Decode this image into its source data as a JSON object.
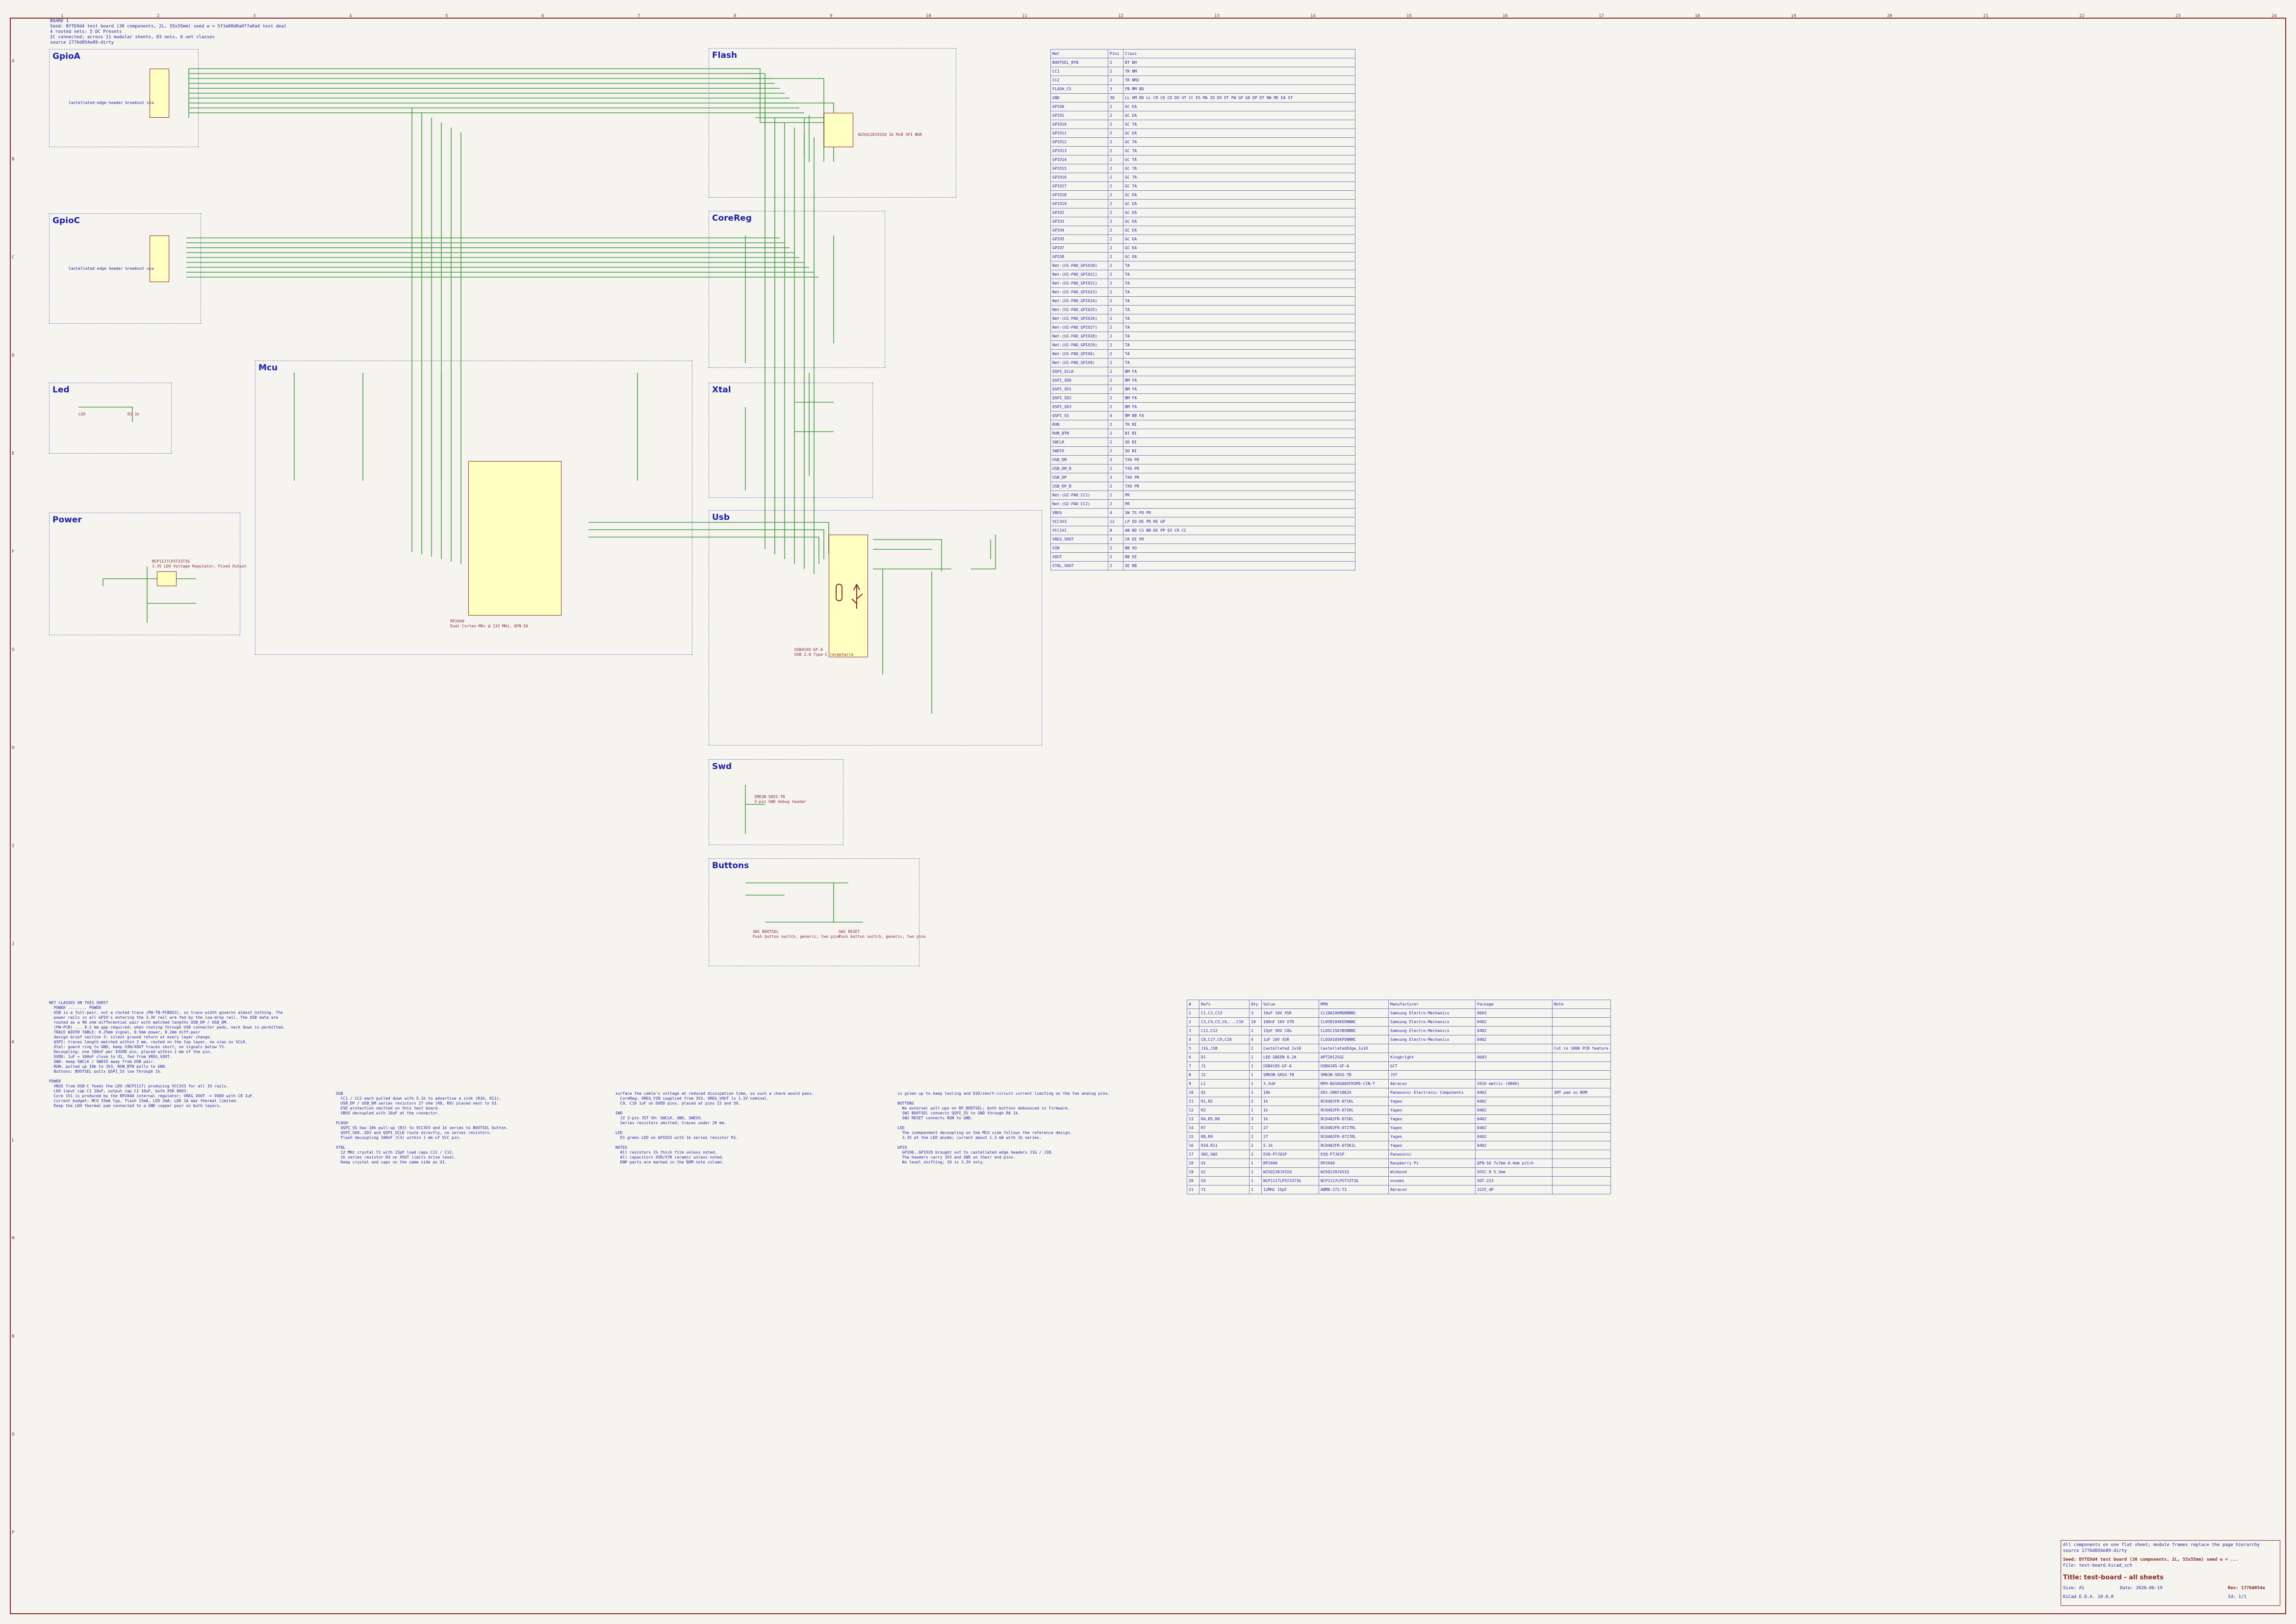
{
  "header": {
    "text": "BOARD 1\nSeed: BYTE0d4 test board (30 components, 2L, 55x55mm) seed w = 5f3a00d0a0f7a0a4 test deal\n4 rooted nets: 5 DC Presets\nIC connected; across 11 modular sheets, 83 nets, 8 net classes\nsource 1776d054e89-dirty"
  },
  "sheets": [
    {
      "id": "gpioa",
      "title": "GpioA"
    },
    {
      "id": "gpioc",
      "title": "GpioC"
    },
    {
      "id": "led",
      "title": "Led"
    },
    {
      "id": "power",
      "title": "Power"
    },
    {
      "id": "mcu",
      "title": "Mcu"
    },
    {
      "id": "flash",
      "title": "Flash"
    },
    {
      "id": "corereg",
      "title": "CoreReg"
    },
    {
      "id": "xtal",
      "title": "Xtal"
    },
    {
      "id": "usb",
      "title": "Usb"
    },
    {
      "id": "swd",
      "title": "Swd"
    },
    {
      "id": "buttons",
      "title": "Buttons"
    }
  ],
  "labels": {
    "gpioa_conn": "Castellated-edge-header breakout via",
    "gpioc_conn": "Castellated edge header breakout via",
    "flash_note": "W25Q128JVSIQ 16 MiB SPI NOR",
    "mcu_part": "RP2040",
    "mcu_desc": "Dual Cortex-M0+ @ 133 MHz, QFN-56",
    "usb_part": "USB4105-GF-A",
    "usb_desc": "USB 2.0 Type-C receptacle",
    "swd_part": "SM03B-SRSS-TB",
    "swd_desc": "3-pin SWD debug header",
    "btn1": "SW1 BOOTSEL",
    "btn2": "SW2 RESET",
    "btn_desc": "Push button switch, generic, two pins",
    "led_part": "LED",
    "led_res": "R1 1k",
    "reg_part": "NCP1117LPST33T3G",
    "reg_desc": "3.3V LDO Voltage Regulator, Fixed Output"
  },
  "netlist": {
    "headers": [
      "Net",
      "Pins",
      "Class"
    ],
    "rows": [
      [
        "BOOTSEL_BTN",
        "2",
        "BT BH"
      ],
      [
        "CC1",
        "2",
        "TR NM"
      ],
      [
        "CC2",
        "2",
        "TR NM2"
      ],
      [
        "FLASH_CS",
        "3",
        "FB MM BD"
      ],
      [
        "GND",
        "30",
        "LL HM DD LL CR CD CD DO UT CC ES MA ID DO DT PW GP GD DP DT NW ME EA ST"
      ],
      [
        "GPIO0",
        "2",
        "GC EA"
      ],
      [
        "GPIO1",
        "2",
        "GC EA"
      ],
      [
        "GPIO10",
        "2",
        "GC TA"
      ],
      [
        "GPIO11",
        "2",
        "GC EA"
      ],
      [
        "GPIO12",
        "2",
        "GC TA"
      ],
      [
        "GPIO13",
        "2",
        "GC TA"
      ],
      [
        "GPIO14",
        "2",
        "GC TA"
      ],
      [
        "GPIO15",
        "2",
        "GC TA"
      ],
      [
        "GPIO16",
        "2",
        "GC TA"
      ],
      [
        "GPIO17",
        "2",
        "GC TA"
      ],
      [
        "GPIO18",
        "2",
        "GC EA"
      ],
      [
        "GPIO19",
        "2",
        "GC EA"
      ],
      [
        "GPIO2",
        "2",
        "GC EA"
      ],
      [
        "GPIO3",
        "2",
        "GC EA"
      ],
      [
        "GPIO4",
        "2",
        "GC EA"
      ],
      [
        "GPIO5",
        "2",
        "GC EA"
      ],
      [
        "GPIO7",
        "2",
        "GC EA"
      ],
      [
        "GPIO8",
        "2",
        "GC EA"
      ],
      [
        "Net-(U1-PAD_GPIO20)",
        "2",
        "TA"
      ],
      [
        "Net-(U1-PAD_GPIO21)",
        "2",
        "TA"
      ],
      [
        "Net-(U1-PAD_GPIO22)",
        "2",
        "TA"
      ],
      [
        "Net-(U1-PAD_GPIO23)",
        "2",
        "TA"
      ],
      [
        "Net-(U1-PAD_GPIO24)",
        "2",
        "TA"
      ],
      [
        "Net-(U1-PAD_GPIO25)",
        "2",
        "TA"
      ],
      [
        "Net-(U1-PAD_GPIO26)",
        "2",
        "TA"
      ],
      [
        "Net-(U1-PAD_GPIO27)",
        "2",
        "TA"
      ],
      [
        "Net-(U1-PAD_GPIO28)",
        "2",
        "TA"
      ],
      [
        "Net-(U1-PAD_GPIO29)",
        "2",
        "TA"
      ],
      [
        "Net-(U1-PAD_GPIO6)",
        "2",
        "TA"
      ],
      [
        "Net-(U1-PAD_GPIO9)",
        "2",
        "TA"
      ],
      [
        "QSPI_SCLK",
        "2",
        "BM FA"
      ],
      [
        "QSPI_SD0",
        "2",
        "BM FA"
      ],
      [
        "QSPI_SD1",
        "2",
        "BM FA"
      ],
      [
        "QSPI_SD2",
        "2",
        "BM FA"
      ],
      [
        "QSPI_SD3",
        "2",
        "BM FA"
      ],
      [
        "QSPI_SS",
        "4",
        "BM BB FA"
      ],
      [
        "RUN",
        "2",
        "TR BI"
      ],
      [
        "RUN_BTN",
        "2",
        "BI BI"
      ],
      [
        "SWCLK",
        "2",
        "SD BI"
      ],
      [
        "SWDIO",
        "2",
        "SD BI"
      ],
      [
        "USB_DM",
        "3",
        "TXO PR"
      ],
      [
        "USB_DM_B",
        "2",
        "TXO PR"
      ],
      [
        "USB_DP",
        "3",
        "TXO PR"
      ],
      [
        "USB_DP_B",
        "2",
        "TXO PR"
      ],
      [
        "Net-(U2-PAD_CC1)",
        "2",
        "PR"
      ],
      [
        "Net-(U2-PAD_CC2)",
        "2",
        "PR"
      ],
      [
        "VBUS",
        "4",
        "SW TS PO PR"
      ],
      [
        "VCC3V3",
        "12",
        "LP ED DE PR RE GP"
      ],
      [
        "VCC1V1",
        "8",
        "AB BD CS BB DE PP EX CR CC"
      ],
      [
        "VREG_VOUT",
        "3",
        "CR EE PR"
      ],
      [
        "XIN",
        "2",
        "BB XO"
      ],
      [
        "XOUT",
        "2",
        "BB EE"
      ],
      [
        "XTAL_XOUT",
        "2",
        "XE BB"
      ]
    ]
  },
  "bom": {
    "headers": [
      "#",
      "Refs",
      "Qty",
      "Value",
      "MPN",
      "Manufacturer",
      "Package",
      "Note"
    ],
    "rows": [
      [
        "1",
        "C1,C2,C13",
        "3",
        "10uF 10V X5R",
        "CL10A106MQ8NNNC",
        "Samsung Electro-Mechanics",
        "0603",
        ""
      ],
      [
        "2",
        "C3,C4,C5,C6,...C16",
        "10",
        "100nF 16V X7R",
        "CL05B104KO5NNNC",
        "Samsung Electro-Mechanics",
        "0402",
        ""
      ],
      [
        "3",
        "C11,C12",
        "2",
        "15pF 50V C0G",
        "CL05C150JB5NNNC",
        "Samsung Electro-Mechanics",
        "0402",
        ""
      ],
      [
        "4",
        "C8,C17,C9,C10",
        "4",
        "1uF 10V X5R",
        "CL05A105KP5NNNC",
        "Samsung Electro-Mechanics",
        "0402",
        ""
      ],
      [
        "5",
        "J1G,J1B",
        "2",
        "Castellated 1x10",
        "CastellatedEdge_1x10",
        "",
        "",
        "Cut in 1000 PCB feature"
      ],
      [
        "6",
        "D1",
        "1",
        "LED GREEN 0.2A",
        "APT2012SGC",
        "Kingbright",
        "0603",
        ""
      ],
      [
        "7",
        "J1",
        "1",
        "USB4105-GF-A",
        "USB4105-GF-A",
        "GCT",
        "",
        ""
      ],
      [
        "8",
        "J2",
        "1",
        "SM03B-SRSS-TB",
        "SM03B-SRSS-TB",
        "JST",
        "",
        ""
      ],
      [
        "9",
        "L1",
        "1",
        "3.3uH",
        "MPH-BGS0GA0SFR3M5-CIN-T",
        "Abracon",
        "2016 metric (0806)",
        ""
      ],
      [
        "10",
        "Q1",
        "1",
        "10k",
        "ERJ-2RKF1002X",
        "Panasonic Electronic Components",
        "0402",
        "SMT pad on BOM"
      ],
      [
        "11",
        "R1,R2",
        "2",
        "1k",
        "RC0402FR-071KL",
        "Yageo",
        "0402",
        ""
      ],
      [
        "12",
        "R3",
        "1",
        "1k",
        "RC0402FR-071KL",
        "Yageo",
        "0402",
        ""
      ],
      [
        "13",
        "R4,R5,R6",
        "3",
        "1k",
        "RC0402FR-071KL",
        "Yageo",
        "0402",
        ""
      ],
      [
        "14",
        "R7",
        "1",
        "27",
        "RC0402FR-0727RL",
        "Yageo",
        "0402",
        ""
      ],
      [
        "15",
        "R8,R9",
        "2",
        "27",
        "RC0402FR-0727RL",
        "Yageo",
        "0402",
        ""
      ],
      [
        "16",
        "R10,R11",
        "2",
        "5.1k",
        "RC0402FR-075K1L",
        "Yageo",
        "0402",
        ""
      ],
      [
        "17",
        "SW1,SW2",
        "2",
        "EVQ-P7J01P",
        "EVQ-P7J01P",
        "Panasonic",
        "",
        ""
      ],
      [
        "18",
        "U1",
        "1",
        "RP2040",
        "RP2040",
        "Raspberry Pi",
        "QFN-56 7x7mm 0.4mm pitch",
        ""
      ],
      [
        "19",
        "U2",
        "1",
        "W25Q128JVSIQ",
        "W25Q128JVSIQ",
        "Winbond",
        "SOIC-8 5.3mm",
        ""
      ],
      [
        "20",
        "U3",
        "1",
        "NCP1117LPST33T3G",
        "NCP1117LPST33T3G",
        "onsemi",
        "SOT-223",
        ""
      ],
      [
        "21",
        "Y1",
        "1",
        "12MHz 15pF",
        "ABM8-272-T3",
        "Abracon",
        "3225_4P",
        ""
      ]
    ]
  },
  "notes": {
    "col1": "NET CLASSES ON THIS SHEET\n  POWER ........ POWER\n  USB is a full-pair, not a routed trace (PW-TB-PCB053), so trace width governs almost nothing. The\n  power rails in all GPIO's entering the 3.3V rail are fed by the low-drop rail. The USB data are\n  routed as a 90 ohm differential pair with matched lengths USB_DP / USB_DM.\n  (PW-PCB) ... 0.2 mm gap required; when routing through USB connector pads, neck down is permitted.\n  TRACE WIDTH TABLE: 0.25mm signal, 0.5mm power, 0.2mm diff-pair\n  design brief section 3: silent ground return at every layer change.\n  QSPI: traces length matched within 2 mm, routed on the top layer, no vias on SCLK.\n  Xtal: guard ring to GND, keep XIN/XOUT traces short, no signals below Y1.\n  Decoupling: one 100nF per IOVDD pin, placed within 1 mm of the pin.\n  DVDD: 1uF + 100nF close to U1, fed from VREG_VOUT.\n  SWD: keep SWCLK / SWDIO away from USB pair.\n  RUN: pulled up 10k to 3V3, RUN_BTN pulls to GND.\n  Buttons: BOOTSEL pulls QSPI_SS low through 1k.\n\nPOWER\n  VBUS from USB-C feeds the LDO (NCP1117) producing VCC3V3 for all IO rails.\n  LDO input cap C1 10uF, output cap C2 10uF, both X5R 0603.\n  Core 1V1 is produced by the RP2040 internal regulator; VREG_VOUT -> DVDD with C8 1uF.\n  Current budget: MCU 25mA typ, flash 15mA, LED 2mA; LDO 1A max thermal limited.\n  Keep the LDO thermal pad connected to a GND copper pour on both layers.",
    "col2": "USB\n  CC1 / CC2 each pulled down with 5.1k to advertise a sink (R10, R11).\n  USB_DP / USB_DM series resistors 27 ohm (R8, R9) placed next to U1.\n  ESD protection omitted on this test board.\n  VBUS decoupled with 10uF at the connector.\n\nFLASH\n  QSPI_SS has 10k pull-up (R3) to VCC3V3 and 1k series to BOOTSEL button.\n  QSPI_SD0..SD3 and QSPI_SCLK route directly, no series resistors.\n  Flash decoupling 100nF (C3) within 1 mm of VCC pin.\n\nXTAL\n  12 MHz crystal Y1 with 15pF load caps C11 / C12.\n  1k series resistor R4 on XOUT limits drive level.\n  Keep crystal and caps on the same side as U1.",
    "col3": "surface the cable's voltage at reduced dissipation time, so such a check would pass.\n  CoreReg: VREG_VIN supplied from 3V3, VREG_VOUT is 1.1V nominal.\n  C9, C10 1uF on DVDD pins, placed at pins 23 and 50.\n\nSWD\n  J2 3-pin JST SH: SWCLK, GND, SWDIO.\n  Series resistors omitted; traces under 20 mm.\n\nLED\n  D1 green LED on GPIO25 with 1k series resistor R1.\n\nNOTES\n  All resistors 1% thick film unless noted.\n  All capacitors X5R/X7R ceramic unless noted.\n  DNP parts are marked in the BOM note column.",
    "col4": "is given up to keep tooling and ESD/short-circuit current limiting on the two analog pins.\n\nBUTTONS\n  No external pull-ups on RP_BOOTSEL; both buttons debounced in firmware.\n  SW1 BOOTSEL connects QSPI_SS to GND through R6 1k.\n  SW2 RESET connects RUN to GND.\n\nLED\n  The independent decoupling on the MCU side follows the reference design.\n  3.3V at the LED anode; current about 1.3 mA with 1k series.\n\nGPIO\n  GPIO0..GPIO29 brought out to castellated edge headers J1G / J1B.\n  The headers carry 3V3 and GND on their end pins.\n  No level shifting; IO is 3.3V only."
  },
  "title_block": {
    "line1": "All components on one flat sheet; module frames replace the page hierarchy",
    "line2": "source 1776d054e89-dirty",
    "line3": "Seed: BYTE0d4 test board (30 components, 2L, 55x55mm) seed w = ...",
    "line4": "Title: test-board - all sheets",
    "size": "Size: A1",
    "date": "Date: 2026-06-19",
    "rev": "Rev: 1776d054e",
    "kicad": "KiCad E.D.A. 10.0.0",
    "id": "Id: 1/1",
    "file": "File: test-board.kicad_sch"
  },
  "colors": {
    "wire": "#4aa04a",
    "border": "#8a2a2a",
    "text": "#1b1fa8",
    "ic_fill": "#ffffc2"
  }
}
